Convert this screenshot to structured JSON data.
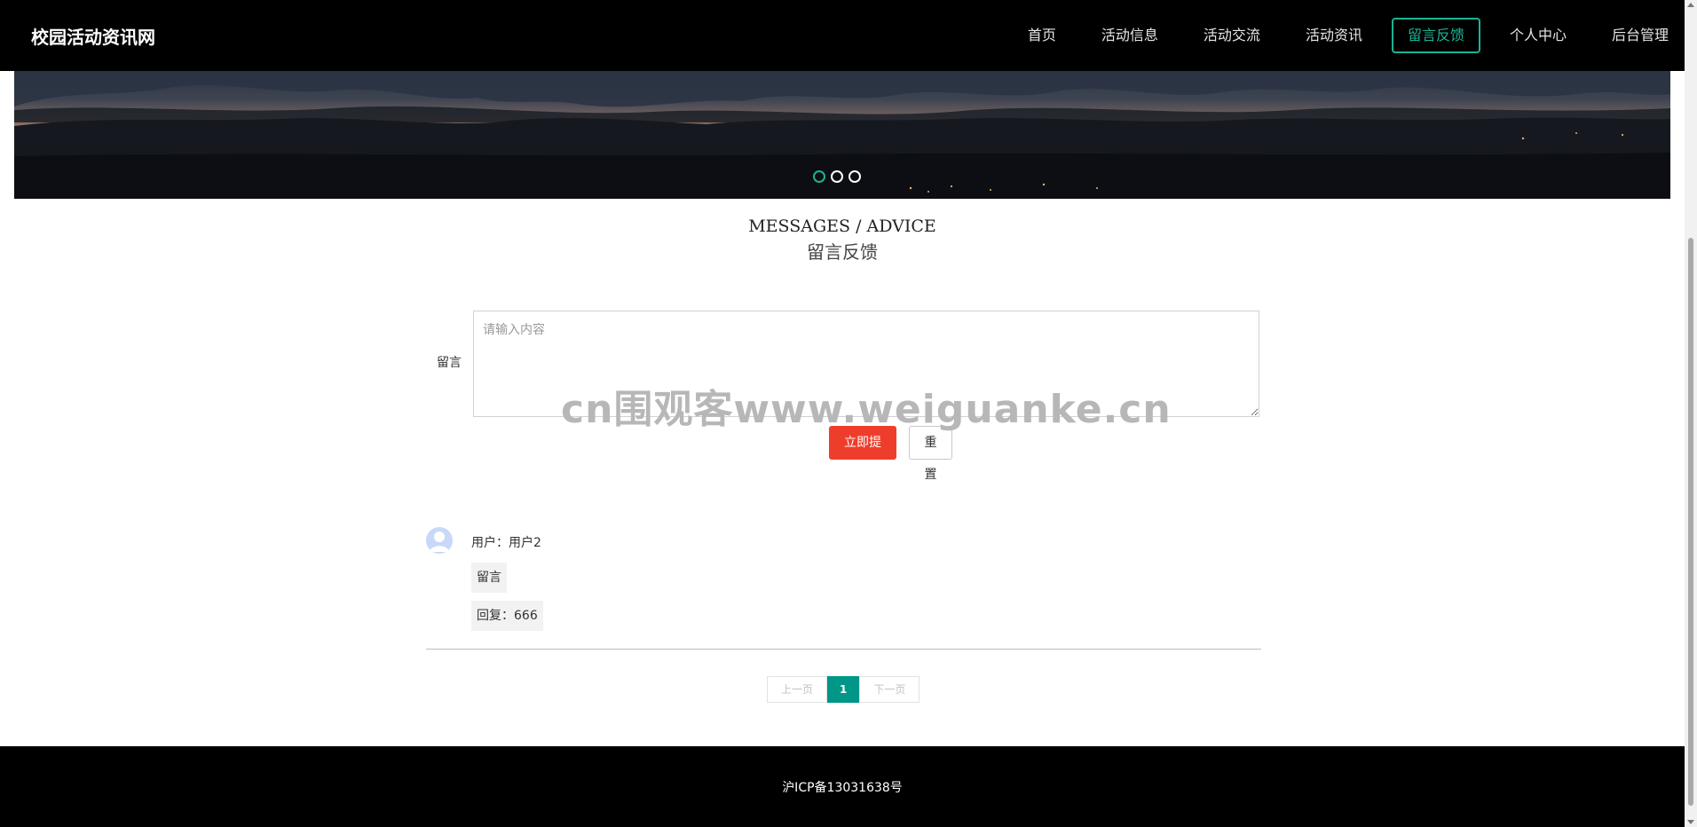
{
  "header": {
    "logo": "校园活动资讯网",
    "nav": [
      {
        "label": "首页",
        "active": false
      },
      {
        "label": "活动信息",
        "active": false
      },
      {
        "label": "活动交流",
        "active": false
      },
      {
        "label": "活动资讯",
        "active": false
      },
      {
        "label": "留言反馈",
        "active": true
      },
      {
        "label": "个人中心",
        "active": false
      },
      {
        "label": "后台管理",
        "active": false
      }
    ]
  },
  "banner": {
    "slides": 3,
    "active_slide": 1
  },
  "section": {
    "title_en": "MESSAGES / ADVICE",
    "title_cn": "留言反馈"
  },
  "form": {
    "label": "留言",
    "placeholder": "请输入内容",
    "value": "",
    "submit_label": "立即提交",
    "reset_label": "重置"
  },
  "watermark": "cn围观客www.weiguanke.cn",
  "comments": [
    {
      "user": "用户：用户2",
      "content": "留言",
      "reply": "回复：666"
    }
  ],
  "pagination": {
    "prev": "上一页",
    "current": "1",
    "next": "下一页"
  },
  "footer": {
    "text": "沪ICP备13031638号"
  },
  "colors": {
    "accent": "#1ab394",
    "submit": "#ee3e2b",
    "pager_active": "#009688"
  },
  "icons": {
    "avatar": "user-avatar-icon"
  }
}
